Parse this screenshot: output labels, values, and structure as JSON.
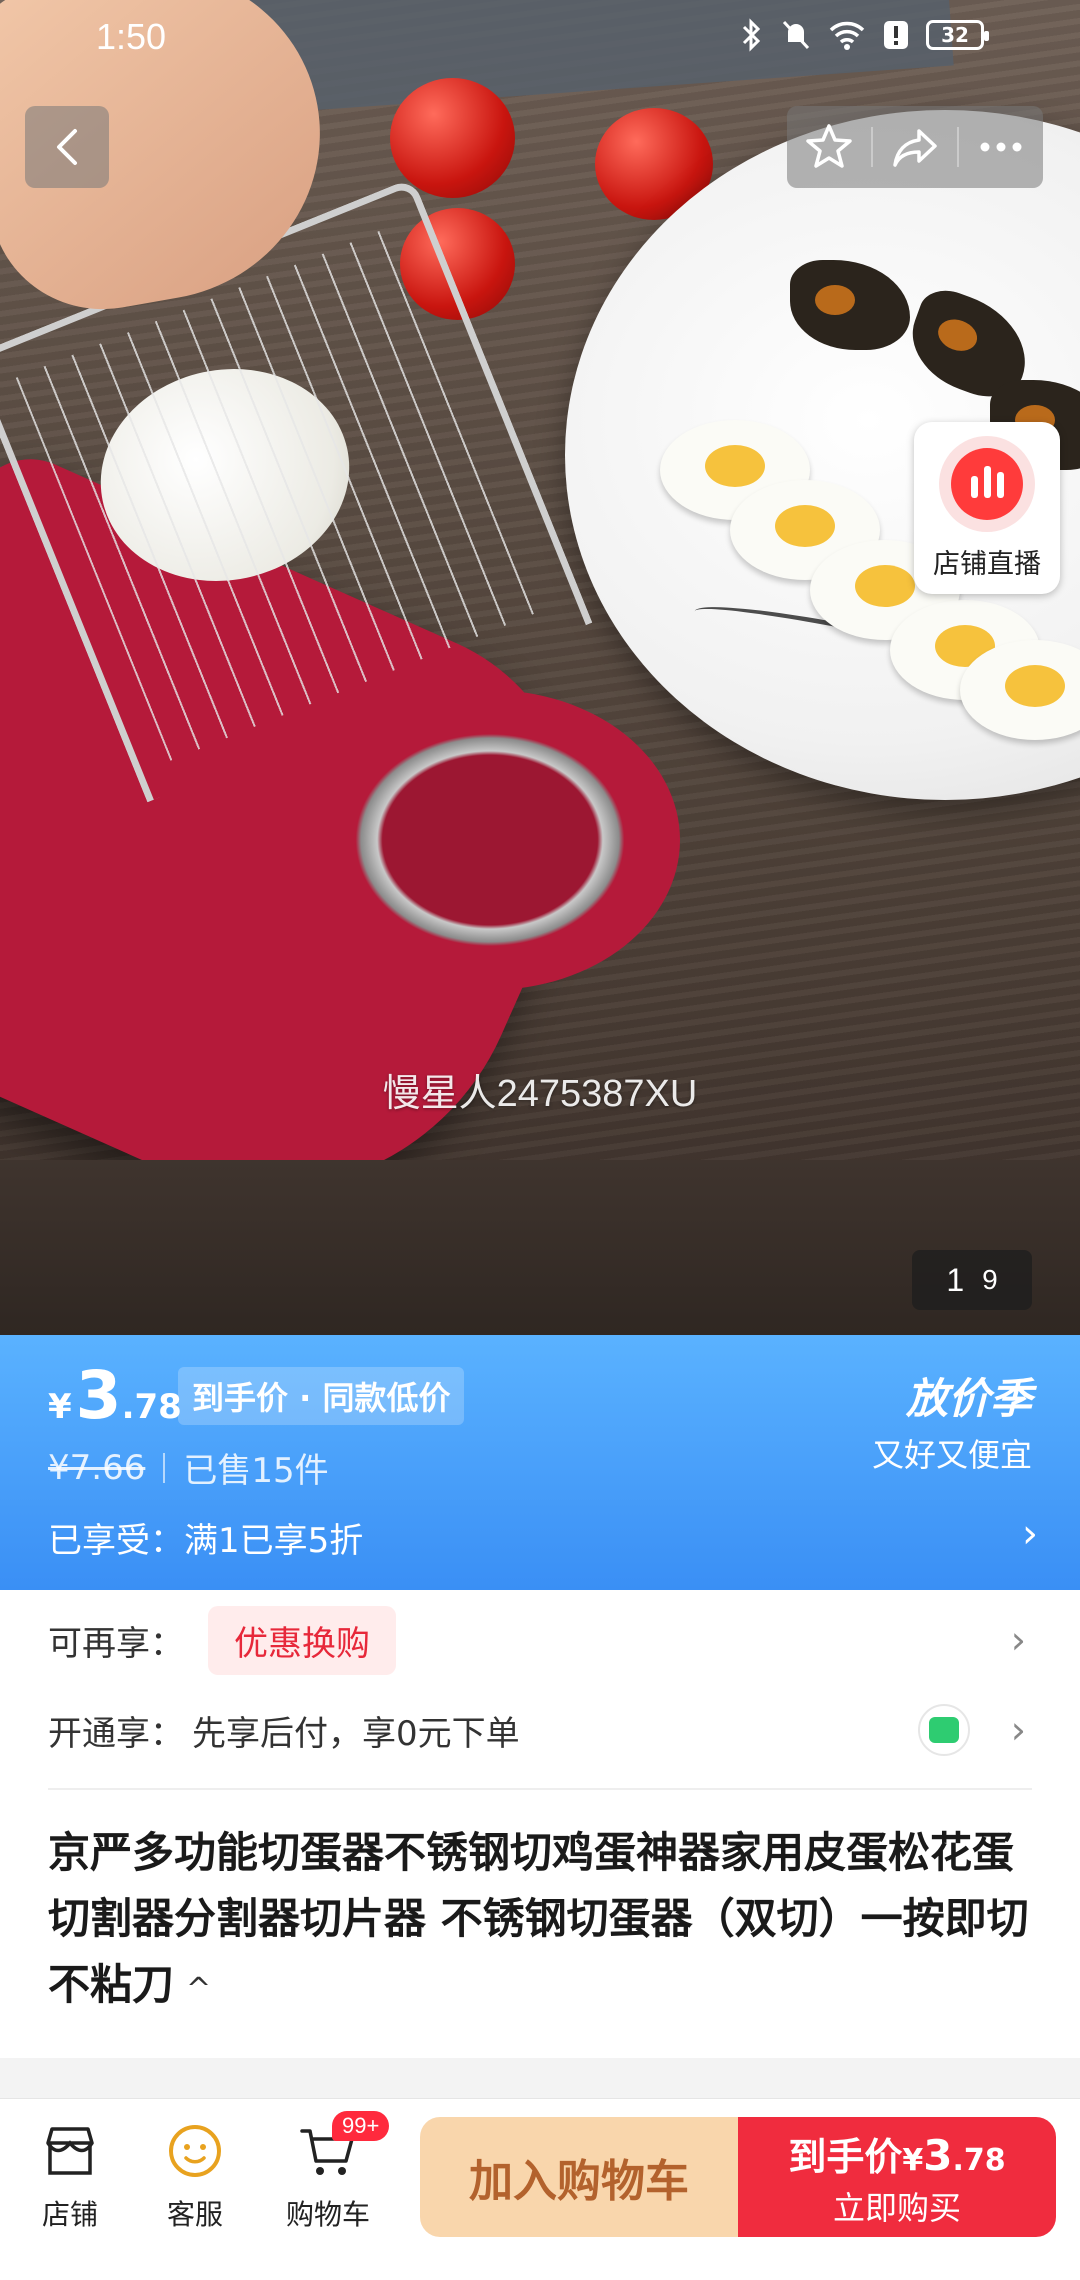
{
  "status_bar": {
    "time": "1:50",
    "battery": "32"
  },
  "image": {
    "watermark": "慢星人2475387XU",
    "current_page": "1",
    "total_pages": "9"
  },
  "live": {
    "label": "店铺直播"
  },
  "price": {
    "currency": "¥",
    "integer": "3",
    "decimal": ".78",
    "tag": "到手价 · 同款低价",
    "original": "¥7.66",
    "sold": "已售15件",
    "promo": "已享受：满1已享5折",
    "season_title": "放价季",
    "season_sub": "又好又便宜"
  },
  "info": {
    "extra_key": "可再享：",
    "extra_chip": "优惠换购",
    "open_key": "开通享：",
    "open_value": "先享后付，享0元下单"
  },
  "product": {
    "title": "京严多功能切蛋器不锈钢切鸡蛋神器家用皮蛋松花蛋切割器分割器切片器 不锈钢切蛋器（双切）一按即切不粘刀",
    "collapse_icon": "chevron-up-icon"
  },
  "bottom_bar": {
    "store_label": "店铺",
    "service_label": "客服",
    "cart_label": "购物车",
    "cart_badge": "99+",
    "add_to_cart": "加入购物车",
    "buy_line1_prefix": "到手价",
    "buy_currency": "¥",
    "buy_integer": "3",
    "buy_decimal": ".78",
    "buy_line2": "立即购买"
  },
  "colors": {
    "banner": "#3a8ff5",
    "accent_red": "#f02c3e",
    "cart_button": "#f9d6ac"
  }
}
